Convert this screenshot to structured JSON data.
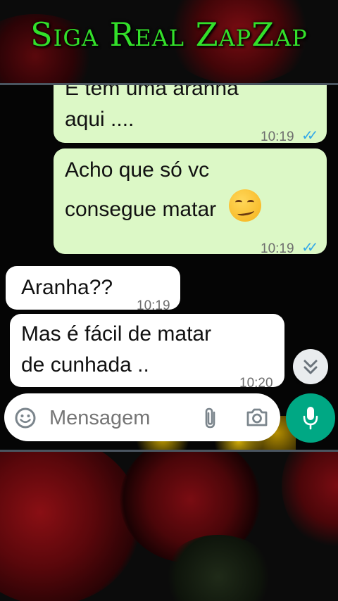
{
  "banner": {
    "title": "Siga Real ZapZap"
  },
  "chat": {
    "messages": [
      {
        "direction": "out",
        "line1": "E tem uma aranha",
        "line2": "aqui ....",
        "time": "10:19",
        "status": "read"
      },
      {
        "direction": "out",
        "line1": "Acho que só vc",
        "line2": "consegue matar",
        "emoji": "smirking-face",
        "time": "10:19",
        "status": "read"
      },
      {
        "direction": "in",
        "line1": "Aranha??",
        "time": "10:19"
      },
      {
        "direction": "in",
        "line1": "Mas é fácil de matar",
        "line2": "de cunhada ..",
        "time": "10:20"
      }
    ]
  },
  "composer": {
    "placeholder": "Mensagem"
  },
  "icons": {
    "emoji": "emoji-icon",
    "attach": "paperclip-icon",
    "camera": "camera-icon",
    "mic": "mic-icon",
    "scroll": "double-chevron-down-icon"
  },
  "colors": {
    "banner_text": "#33e02a",
    "outgoing_bubble": "#dcf8c6",
    "incoming_bubble": "#ffffff",
    "read_ticks": "#34a8e8",
    "mic_button": "#00a884"
  }
}
